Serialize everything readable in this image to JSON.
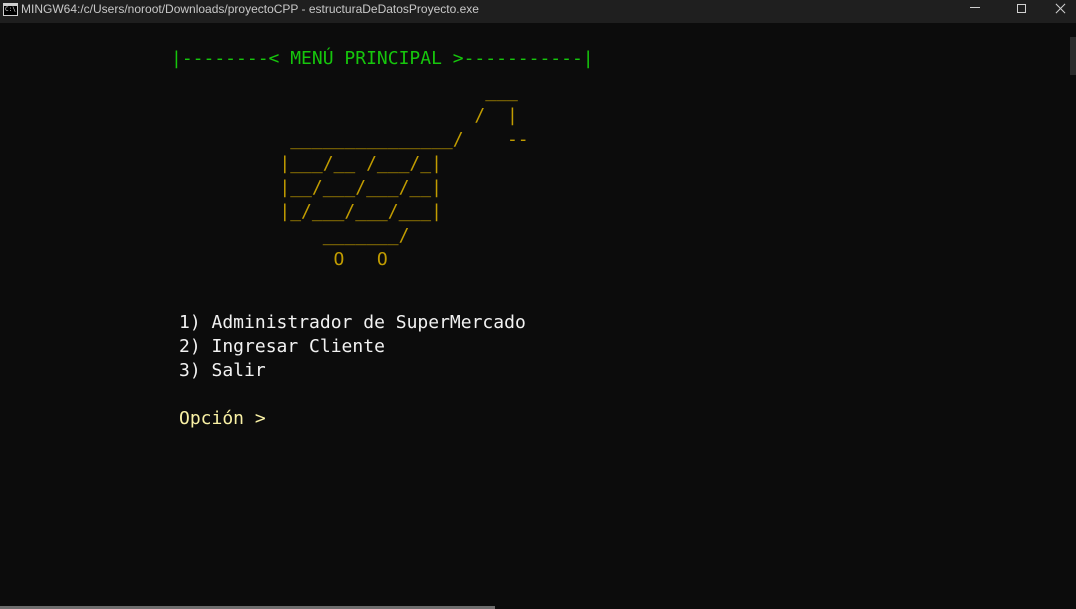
{
  "window": {
    "title": "MINGW64:/c/Users/noroot/Downloads/proyectoCPP - estructuraDeDatosProyecto.exe",
    "icon": "console-icon",
    "controls": [
      "minimize-icon",
      "maximize-icon",
      "close-icon"
    ]
  },
  "console": {
    "header": "|--------< MENÚ PRINCIPAL >-----------|",
    "cart_art": "                             ___\n                            /  |\n           _______________/    --\n          |___/__ /___/_|\n          |__/___/___/__|\n          |_/___/___/___|\n              _______/\n               O   O",
    "menu": [
      "1) Administrador de SuperMercado",
      "2) Ingresar Cliente",
      "3) Salir"
    ],
    "prompt": "Opción >"
  },
  "colors": {
    "background": "#0c0c0c",
    "titlebar": "#1f1f1f",
    "header_green": "#16c60c",
    "art_yellow": "#c19c00",
    "menu_white": "#f2f2f2",
    "prompt_yellow": "#f9f1a5"
  }
}
